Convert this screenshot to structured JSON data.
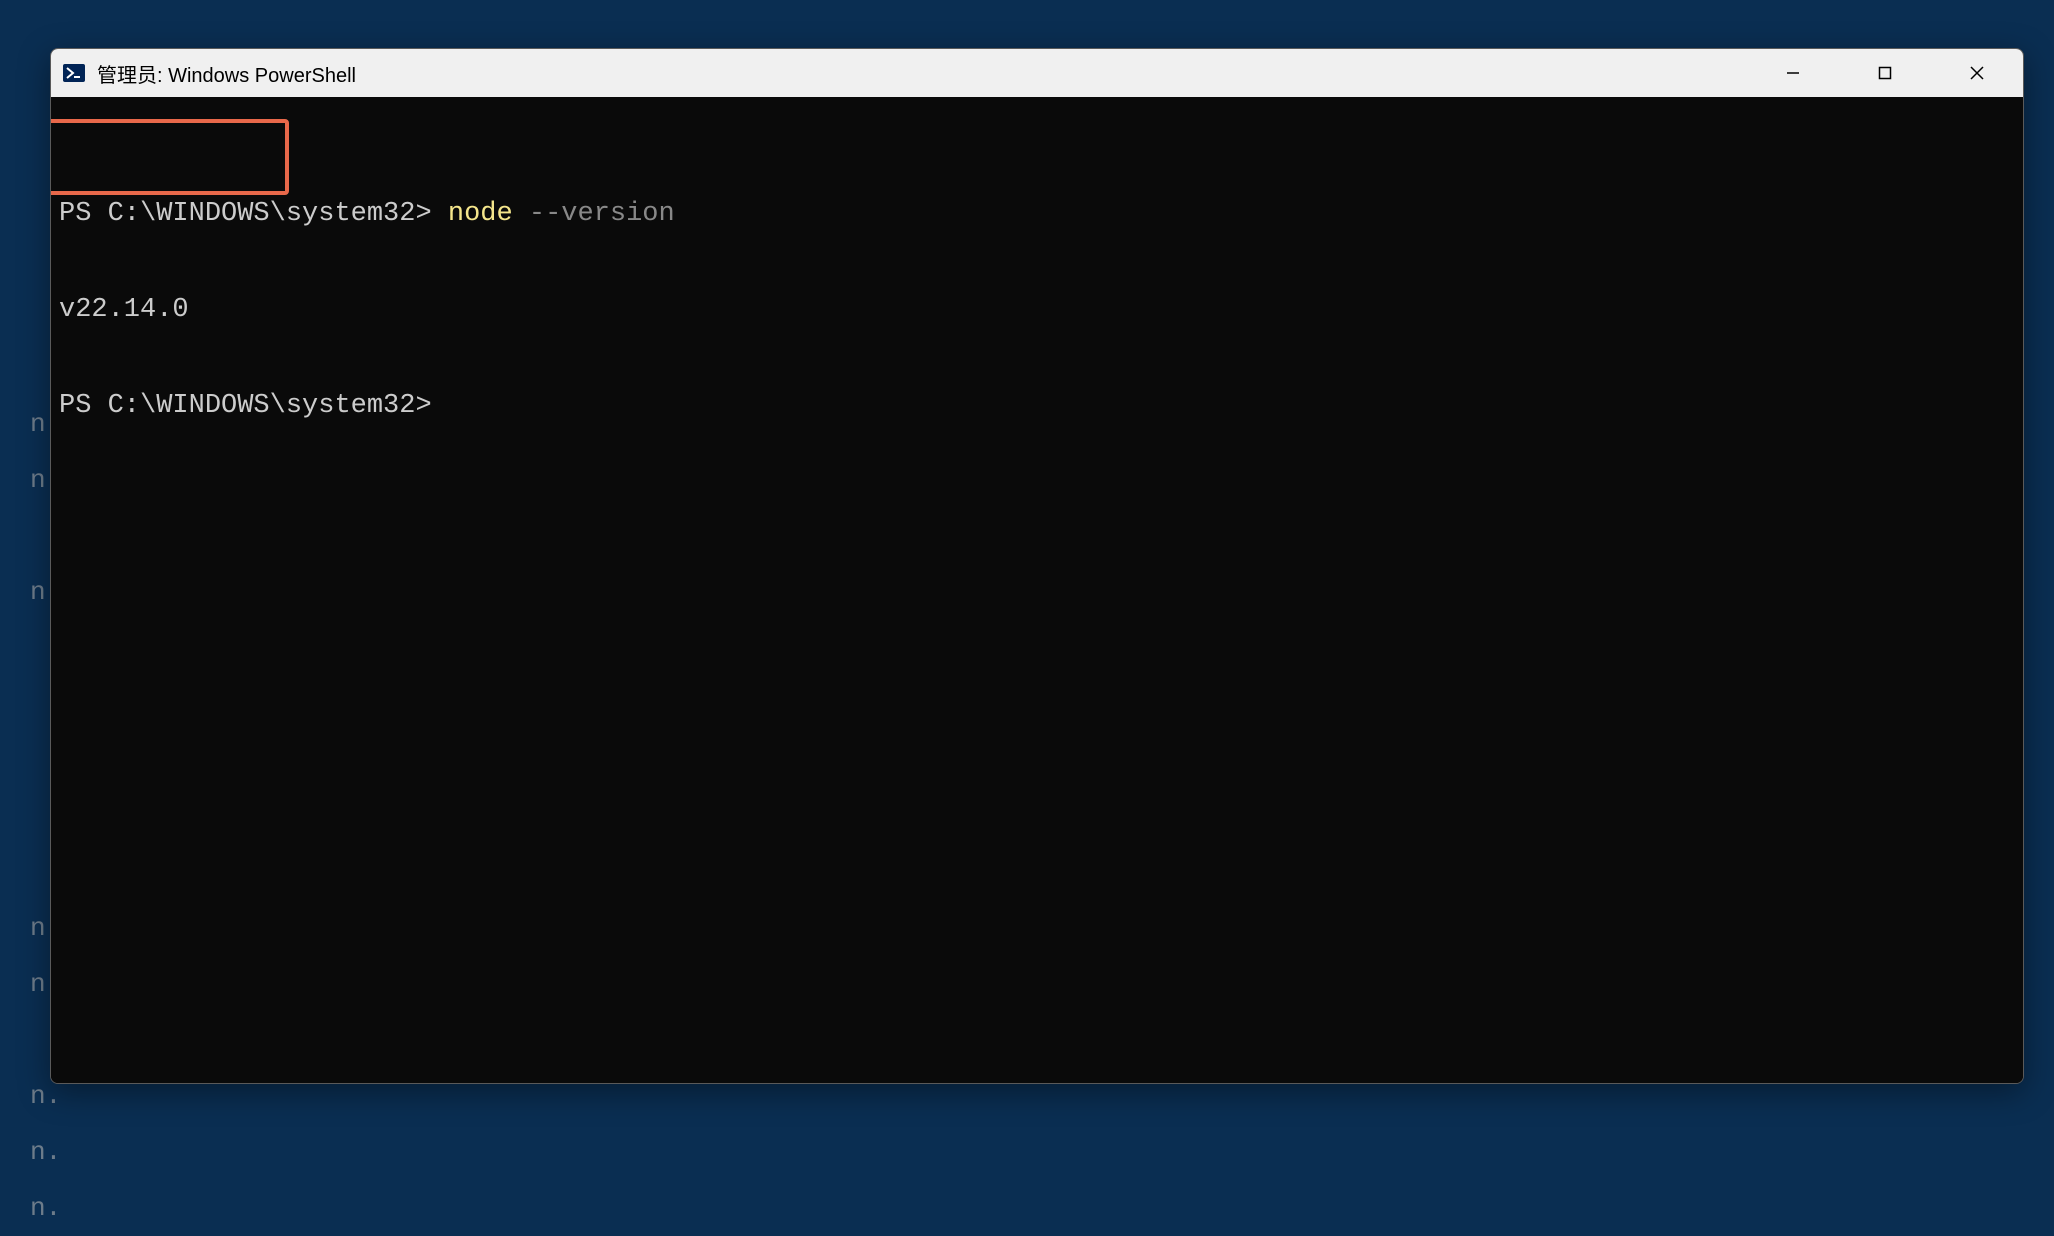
{
  "background": {
    "fragments": "\n\n\n\n\n\nn.\nn.\n\nn.\n\n\n\n\n\nn.\nn.\n\nn.\nn.\nn."
  },
  "window": {
    "title": "管理员: Windows PowerShell"
  },
  "terminal": {
    "lines": [
      {
        "prompt": "PS C:\\WINDOWS\\system32>",
        "command": "node",
        "args": "--version"
      },
      {
        "output": "v22.14.0"
      },
      {
        "prompt": "PS C:\\WINDOWS\\system32>",
        "command": "",
        "args": ""
      }
    ]
  }
}
